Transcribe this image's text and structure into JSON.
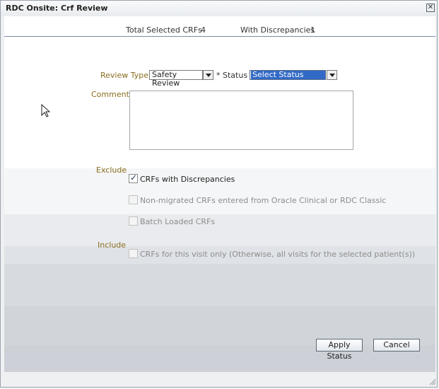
{
  "dialog": {
    "title": "RDC Onsite: Crf Review",
    "close_icon": "close-icon"
  },
  "summary": {
    "total_label": "Total Selected CRFs",
    "total_value": "4",
    "disc_label": "With Discrepancies",
    "disc_value": "1"
  },
  "form": {
    "review_type_label": "Review Type",
    "review_type_value": "Safety Review",
    "status_label": "* Status",
    "status_value": "Select Status",
    "comment_label": "Comment",
    "comment_value": ""
  },
  "exclude": {
    "label": "Exclude",
    "options": [
      {
        "label": "CRFs with Discrepancies",
        "checked": true,
        "enabled": true
      },
      {
        "label": "Non-migrated CRFs entered from Oracle Clinical or RDC Classic",
        "checked": false,
        "enabled": false
      },
      {
        "label": "Batch Loaded CRFs",
        "checked": false,
        "enabled": false
      }
    ]
  },
  "include": {
    "label": "Include",
    "options": [
      {
        "label": "CRFs for this visit only (Otherwise, all visits for the selected patient(s))",
        "checked": false,
        "enabled": false
      }
    ]
  },
  "buttons": {
    "apply": "Apply Status",
    "cancel": "Cancel"
  },
  "colors": {
    "label_accent": "#8a6d1e",
    "selection": "#3169c6"
  }
}
